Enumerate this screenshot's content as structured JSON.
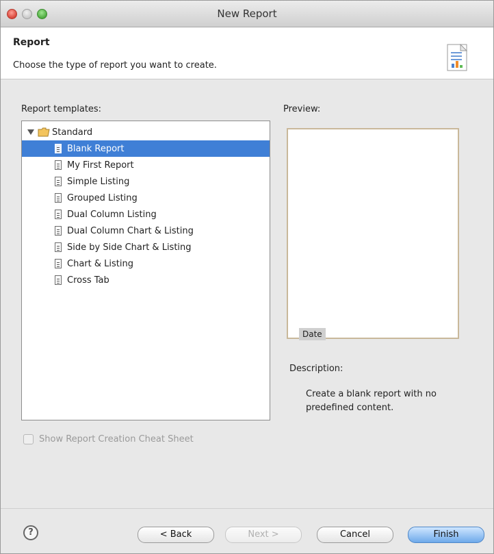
{
  "window": {
    "title": "New Report"
  },
  "header": {
    "title": "Report",
    "subtitle": "Choose the type of report you want to create.",
    "icon": "report-icon"
  },
  "templates": {
    "label": "Report templates:",
    "root": "Standard",
    "items": [
      "Blank Report",
      "My First Report",
      "Simple Listing",
      "Grouped Listing",
      "Dual Column Listing",
      "Dual Column Chart & Listing",
      "Side by Side Chart & Listing",
      "Chart & Listing",
      "Cross Tab"
    ],
    "selected_index": 0
  },
  "preview": {
    "label": "Preview:",
    "field": "Date"
  },
  "description": {
    "label": "Description:",
    "text": "Create a blank report with no predefined content."
  },
  "options": {
    "show_cheat_sheet": "Show Report Creation Cheat Sheet",
    "show_cheat_sheet_checked": false
  },
  "buttons": {
    "back": "< Back",
    "next": "Next >",
    "cancel": "Cancel",
    "finish": "Finish"
  },
  "colors": {
    "selection": "#3f7fd6",
    "finish_button": "#6ea9ea"
  }
}
